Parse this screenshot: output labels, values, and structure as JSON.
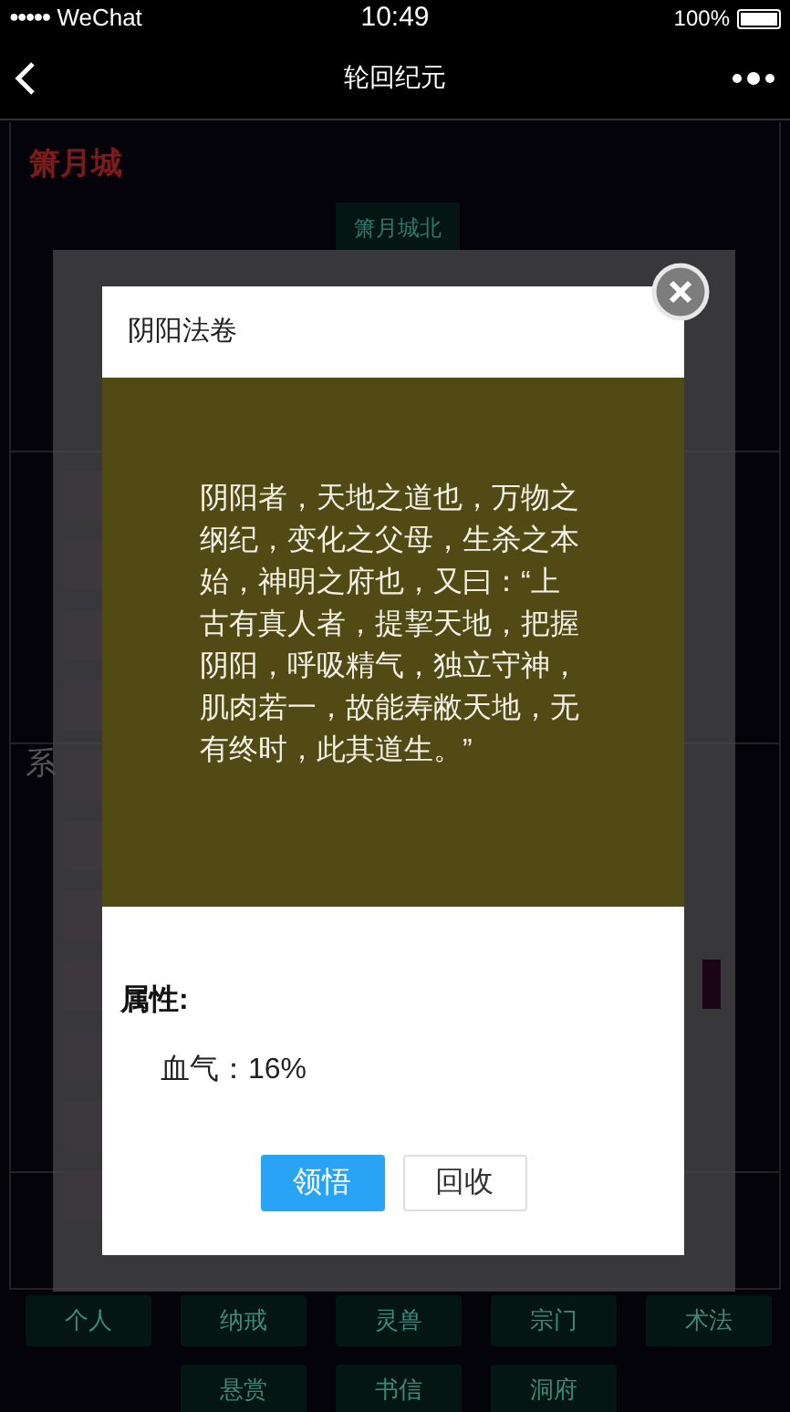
{
  "status_bar": {
    "signal": "●●●●●",
    "carrier": "WeChat",
    "time": "10:49",
    "battery": "100%"
  },
  "nav_bar": {
    "title": "轮回纪元"
  },
  "page": {
    "city": "箫月城",
    "exit_button": "箫月城北",
    "section_label": "系",
    "bottom_nav": [
      {
        "label": "个人"
      },
      {
        "label": "纳戒"
      },
      {
        "label": "灵兽"
      },
      {
        "label": "宗门"
      },
      {
        "label": "术法"
      },
      {
        "label": "悬赏"
      },
      {
        "label": "书信"
      },
      {
        "label": "洞府"
      }
    ]
  },
  "dialog": {
    "title": "阴阳法卷",
    "description": "阴阳者，天地之道也，万物之纲纪，变化之父母，生杀之本始，神明之府也，又曰：“上古有真人者，提挈天地，把握阴阳，呼吸精气，独立守神，肌肉若一，故能寿敝天地，无有终时，此其道生。”",
    "attributes_heading": "属性:",
    "attributes": [
      {
        "name": "血气：",
        "value": "16%"
      }
    ],
    "buttons": [
      {
        "label": "领悟",
        "kind": "primary"
      },
      {
        "label": "回收",
        "kind": "secondary"
      }
    ]
  }
}
